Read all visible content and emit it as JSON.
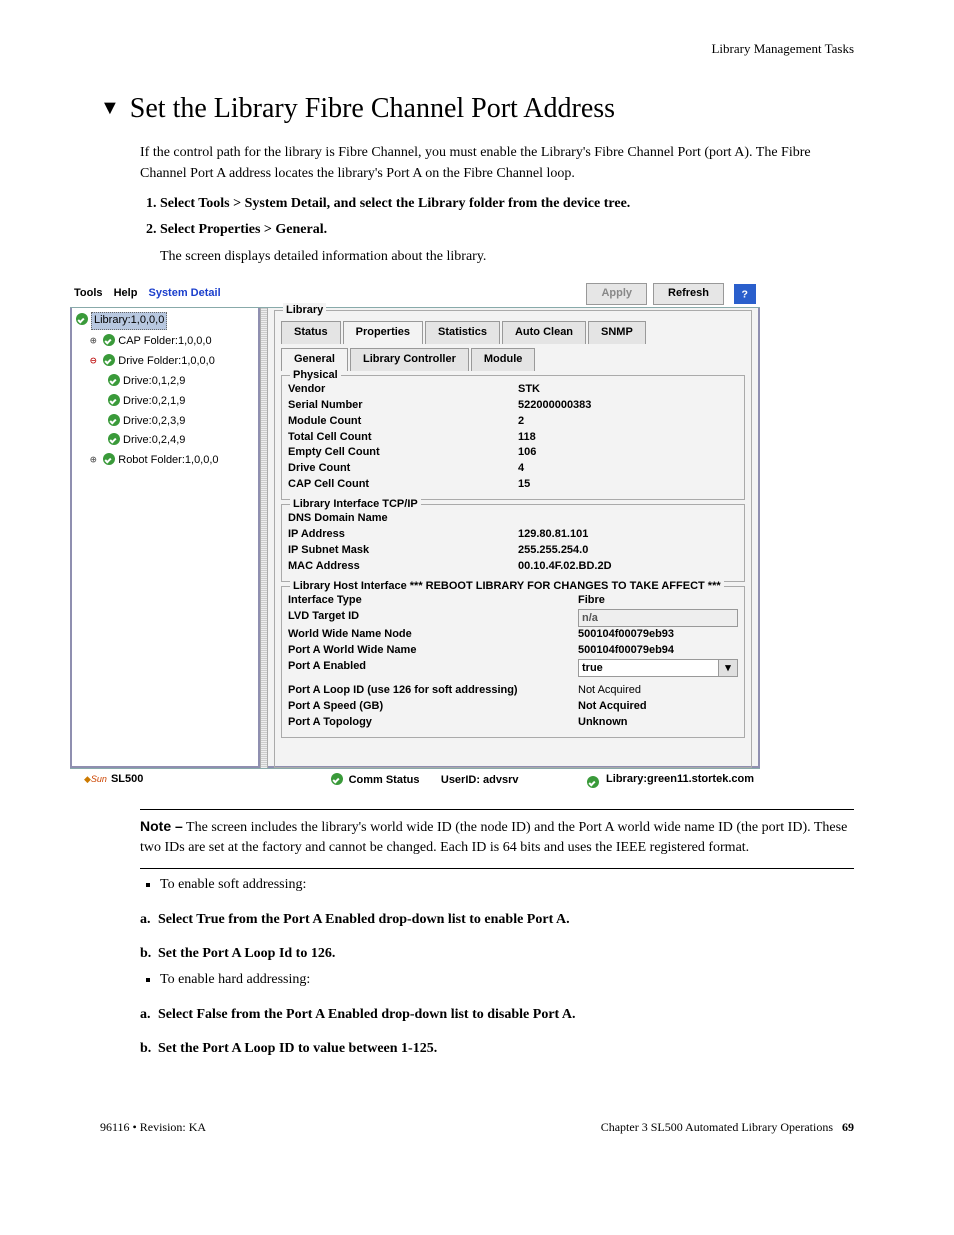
{
  "page_header": "Library Management Tasks",
  "section_title": "Set the Library Fibre Channel Port Address",
  "intro": "If the control path for the library is Fibre Channel, you must enable the Library's Fibre Channel Port (port A). The Fibre Channel Port A address locates the library's Port A on the Fibre Channel loop.",
  "step1": "Select Tools > System Detail, and select the Library folder from the device tree.",
  "step2": "Select Properties > General.",
  "step2_after": "The screen displays detailed information about the library.",
  "shot": {
    "menus": {
      "tools": "Tools",
      "help": "Help",
      "system_detail": "System Detail"
    },
    "buttons": {
      "apply": "Apply",
      "refresh": "Refresh"
    },
    "tree": {
      "n0": "Library:1,0,0,0",
      "n1": "CAP Folder:1,0,0,0",
      "n2": "Drive Folder:1,0,0,0",
      "n3": "Drive:0,1,2,9",
      "n4": "Drive:0,2,1,9",
      "n5": "Drive:0,2,3,9",
      "n6": "Drive:0,2,4,9",
      "n7": "Robot Folder:1,0,0,0"
    },
    "library_legend": "Library",
    "tabs1": {
      "status": "Status",
      "properties": "Properties",
      "statistics": "Statistics",
      "autoclean": "Auto Clean",
      "snmp": "SNMP"
    },
    "tabs2": {
      "general": "General",
      "libctrl": "Library Controller",
      "module": "Module"
    },
    "physical": {
      "legend": "Physical",
      "vendor_l": "Vendor",
      "vendor_v": "STK",
      "serial_l": "Serial Number",
      "serial_v": "522000000383",
      "modc_l": "Module Count",
      "modc_v": "2",
      "total_l": "Total Cell Count",
      "total_v": "118",
      "empty_l": "Empty Cell Count",
      "empty_v": "106",
      "drive_l": "Drive Count",
      "drive_v": "4",
      "cap_l": "CAP Cell Count",
      "cap_v": "15"
    },
    "tcpip": {
      "legend": "Library Interface TCP/IP",
      "dns_l": "DNS Domain Name",
      "dns_v": "",
      "ip_l": "IP Address",
      "ip_v": "129.80.81.101",
      "mask_l": "IP Subnet Mask",
      "mask_v": "255.255.254.0",
      "mac_l": "MAC Address",
      "mac_v": "00.10.4F.02.BD.2D"
    },
    "host": {
      "legend": "Library Host Interface *** REBOOT LIBRARY FOR CHANGES TO TAKE AFFECT ***",
      "itype_l": "Interface Type",
      "itype_v": "Fibre",
      "lvd_l": "LVD Target ID",
      "lvd_v": "n/a",
      "wwnn_l": "World Wide Name Node",
      "wwnn_v": "500104f00079eb93",
      "pawwn_l": "Port A World Wide Name",
      "pawwn_v": "500104f00079eb94",
      "paen_l": "Port A Enabled",
      "paen_v": "true",
      "paloop_l": "Port A Loop ID (use 126 for soft addressing)",
      "paloop_v": "Not Acquired",
      "paspd_l": "Port A Speed (GB)",
      "paspd_v": "Not Acquired",
      "patop_l": "Port A Topology",
      "patop_v": "Unknown"
    },
    "status": {
      "product": "SL500",
      "comm": "Comm Status",
      "user": "UserID: advsrv",
      "lib": "Library:green11.stortek.com"
    }
  },
  "note_label": "Note –",
  "note_body": "The screen includes the library's world wide ID (the node ID) and the Port A world wide name ID (the port ID). These two IDs are set at the factory and cannot be changed. Each ID is 64 bits and uses the IEEE registered format.",
  "soft_intro": "To enable soft addressing:",
  "soft_a": "Select True from the Port A Enabled drop-down list to enable Port A.",
  "soft_b": "Set the Port A Loop Id to 126.",
  "hard_intro": "To enable hard addressing:",
  "hard_a": "Select False from the Port A Enabled drop-down list to disable Port A.",
  "hard_b": "Set the Port A Loop ID to value between 1-125.",
  "footer": {
    "left": "96116 • Revision: KA",
    "right_text": "Chapter 3 SL500 Automated Library Operations",
    "page": "69"
  }
}
